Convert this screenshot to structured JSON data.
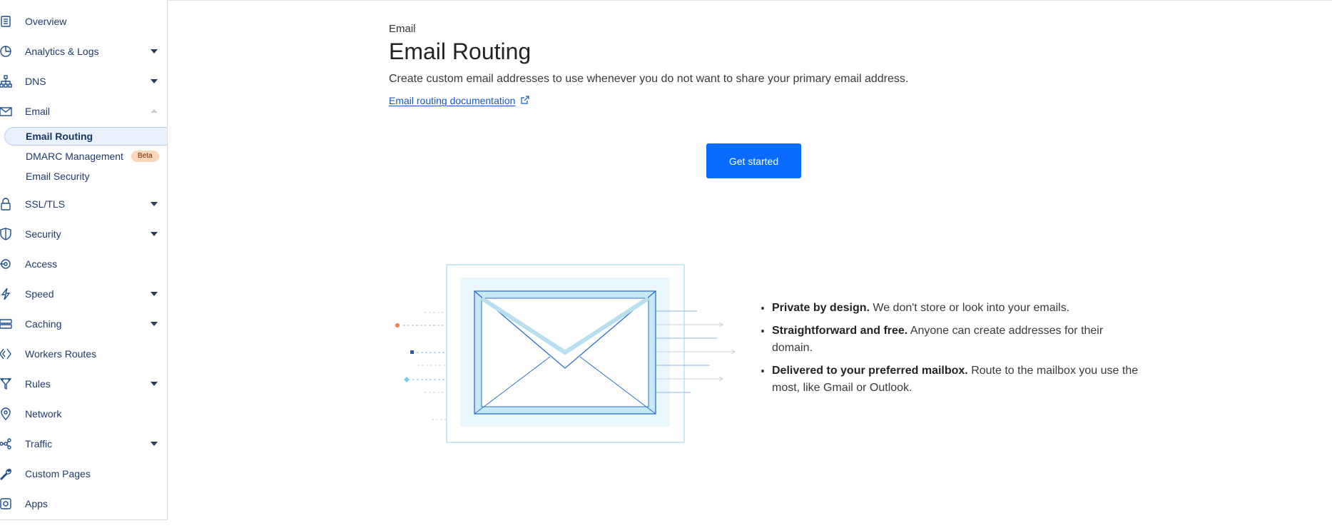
{
  "sidebar": {
    "items": [
      {
        "label": "Overview",
        "icon": "document-icon"
      },
      {
        "label": "Analytics & Logs",
        "icon": "pie-chart-icon"
      },
      {
        "label": "DNS",
        "icon": "network-tree-icon"
      },
      {
        "label": "Email",
        "icon": "mail-icon"
      },
      {
        "label": "SSL/TLS",
        "icon": "lock-icon"
      },
      {
        "label": "Security",
        "icon": "shield-icon"
      },
      {
        "label": "Access",
        "icon": "access-icon"
      },
      {
        "label": "Speed",
        "icon": "lightning-icon"
      },
      {
        "label": "Caching",
        "icon": "server-stack-icon"
      },
      {
        "label": "Workers Routes",
        "icon": "workers-icon"
      },
      {
        "label": "Rules",
        "icon": "funnel-icon"
      },
      {
        "label": "Network",
        "icon": "location-pin-icon"
      },
      {
        "label": "Traffic",
        "icon": "traffic-nodes-icon"
      },
      {
        "label": "Custom Pages",
        "icon": "wrench-icon"
      },
      {
        "label": "Apps",
        "icon": "apps-icon"
      }
    ],
    "email_sub": [
      {
        "label": "Email Routing"
      },
      {
        "label": "DMARC Management",
        "badge": "Beta"
      },
      {
        "label": "Email Security"
      }
    ]
  },
  "main": {
    "breadcrumb": "Email",
    "title": "Email Routing",
    "description": "Create custom email addresses to use whenever you do not want to share your primary email address.",
    "doc_link": "Email routing documentation",
    "cta": "Get started",
    "features": [
      {
        "bold": "Private by design.",
        "text": " We don't store or look into your emails."
      },
      {
        "bold": "Straightforward and free.",
        "text": " Anyone can create addresses for their domain."
      },
      {
        "bold": "Delivered to your preferred mailbox.",
        "text": " Route to the mailbox you use the most, like Gmail or Outlook."
      }
    ]
  },
  "colors": {
    "accent": "#0a6cff",
    "link": "#1458c2",
    "sidebar_text": "#1e3b6a",
    "active_bg": "#e8f1fd",
    "badge_bg": "#fbd6b8"
  }
}
